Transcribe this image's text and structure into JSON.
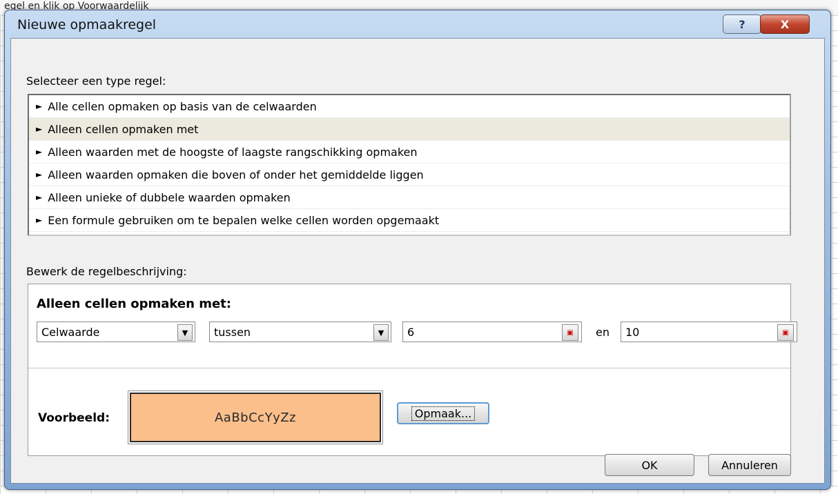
{
  "background": {
    "top_text": "egel en klik op Voorwaardelijk"
  },
  "dialog": {
    "title": "Nieuwe opmaakregel",
    "help_label": "?",
    "close_label": "X",
    "select_type_label": "Selecteer een type regel:",
    "rule_types": [
      {
        "label": "Alle cellen opmaken op basis van de celwaarden",
        "selected": false
      },
      {
        "label": "Alleen cellen opmaken met",
        "selected": true
      },
      {
        "label": "Alleen waarden met de hoogste of laagste rangschikking opmaken",
        "selected": false
      },
      {
        "label": "Alleen waarden opmaken die boven of onder het gemiddelde liggen",
        "selected": false
      },
      {
        "label": "Alleen unieke of dubbele waarden opmaken",
        "selected": false
      },
      {
        "label": "Een formule gebruiken om te bepalen welke cellen worden opgemaakt",
        "selected": false
      }
    ],
    "edit_label": "Bewerk de regelbeschrijving:",
    "edit": {
      "heading": "Alleen cellen opmaken met:",
      "condition_type": "Celwaarde",
      "operator": "tussen",
      "value1": "6",
      "and_label": "en",
      "value2": "10",
      "preview_label": "Voorbeeld:",
      "preview_text": "AaBbCcYyZz",
      "preview_color": "#fbbf8c",
      "format_button": "Opmaak..."
    },
    "ok_label": "OK",
    "cancel_label": "Annuleren"
  }
}
